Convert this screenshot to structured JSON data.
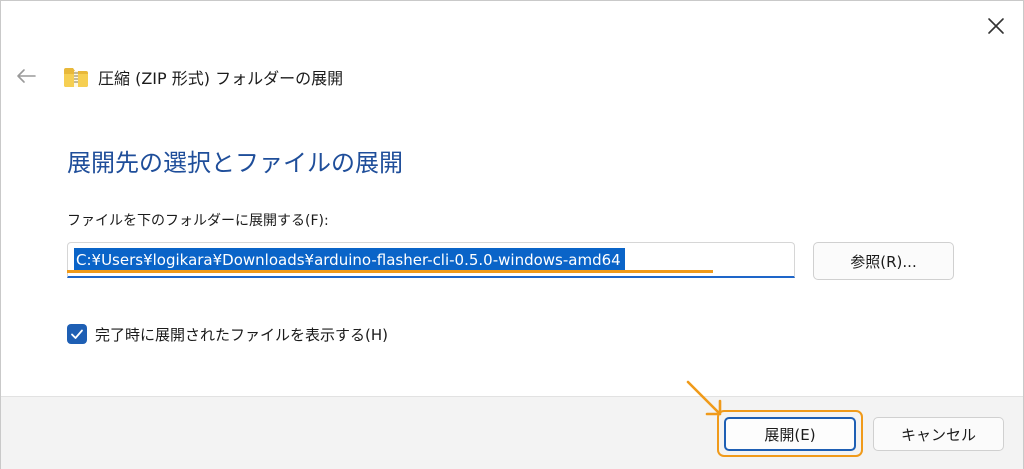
{
  "window": {
    "title": "圧縮 (ZIP 形式) フォルダーの展開",
    "close_icon": "close-icon",
    "back_icon": "back-arrow-icon",
    "folder_icon": "zip-folder-icon"
  },
  "main": {
    "heading": "展開先の選択とファイルの展開",
    "field_label": "ファイルを下のフォルダーに展開する(F):",
    "path_value": "C:¥Users¥logikara¥Downloads¥arduino-flasher-cli-0.5.0-windows-amd64",
    "browse_label": "参照(R)...",
    "checkbox_label": "完了時に展開されたファイルを表示する(H)",
    "checkbox_checked": true
  },
  "footer": {
    "extract_label": "展開(E)",
    "cancel_label": "キャンセル"
  },
  "colors": {
    "heading": "#1f4e9a",
    "selection": "#0a64c8",
    "accent": "#1e5fb4",
    "annotation": "#f09a1a",
    "footer_bg": "#f3f3f3"
  }
}
